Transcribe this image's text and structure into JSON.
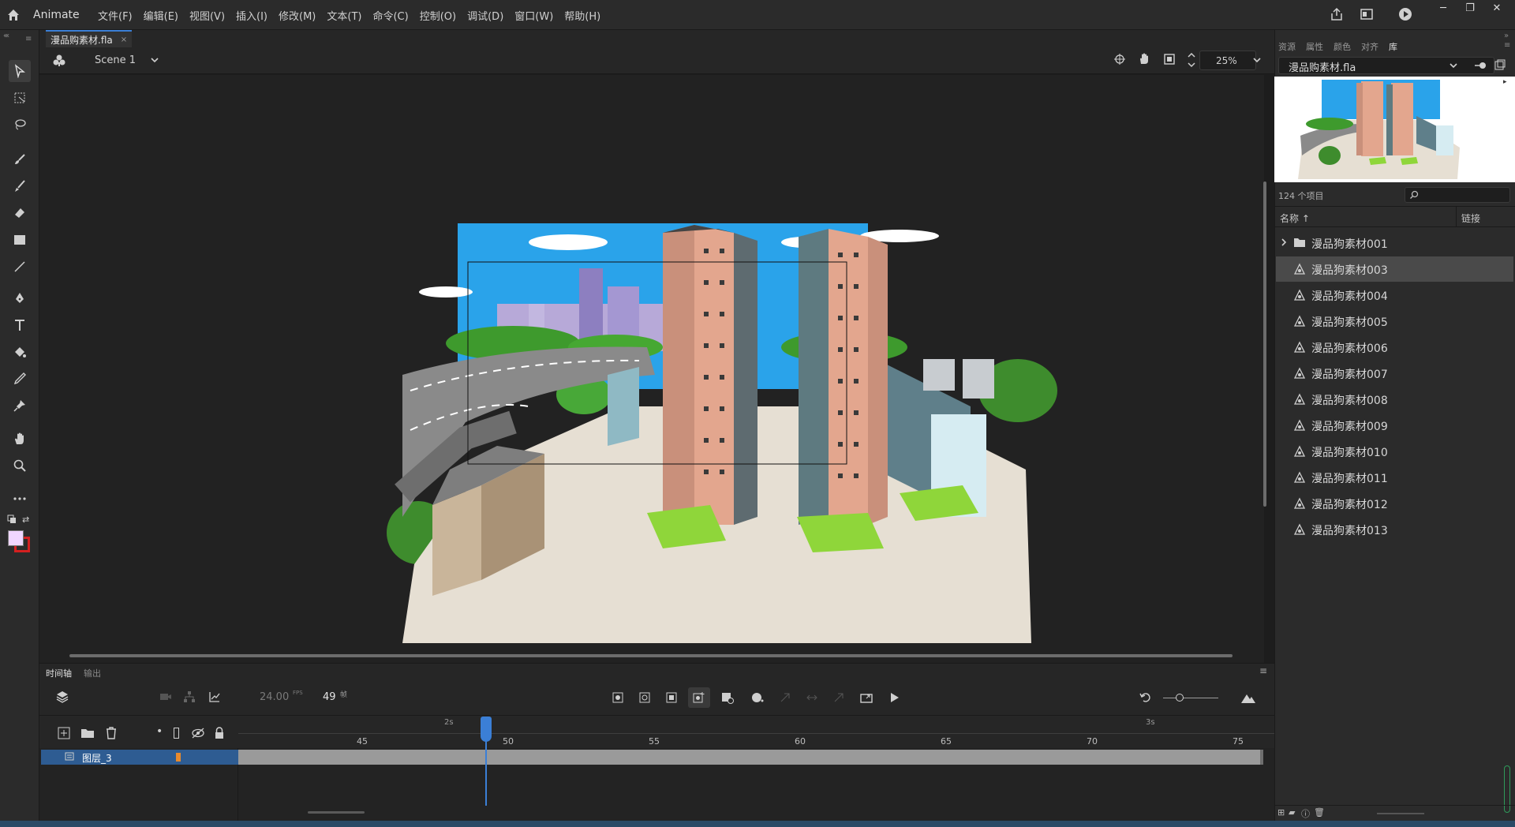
{
  "app": {
    "name": "Animate"
  },
  "menu": [
    "文件(F)",
    "编辑(E)",
    "视图(V)",
    "插入(I)",
    "修改(M)",
    "文本(T)",
    "命令(C)",
    "控制(O)",
    "调试(D)",
    "窗口(W)",
    "帮助(H)"
  ],
  "document": {
    "tab_label": "漫品购素材.fla",
    "tab_close": "×"
  },
  "editbar": {
    "scene": "Scene 1",
    "zoom": "25%"
  },
  "timeline": {
    "tabs": [
      "时间轴",
      "输出"
    ],
    "fps": "24.00",
    "fps_unit": "FPS",
    "current_frame": "49",
    "frame_unit": "帧",
    "ruler_frames": [
      "45",
      "50",
      "55",
      "60",
      "65",
      "70",
      "75"
    ],
    "ruler_seconds": [
      "2s",
      "3s"
    ],
    "playhead_frame": 49,
    "layers": [
      {
        "name": "图层_3"
      }
    ]
  },
  "right_panel": {
    "tabs": [
      "资源",
      "属性",
      "颜色",
      "对齐",
      "库"
    ],
    "active_tab": "库",
    "document_select": "漫品购素材.fla",
    "item_count": "124 个项目",
    "columns": {
      "name": "名称 ↑",
      "linkage": "链接"
    },
    "items": [
      {
        "label": "漫品狗素材001",
        "type": "folder",
        "selected": false
      },
      {
        "label": "漫品狗素材003",
        "type": "graphic",
        "selected": true
      },
      {
        "label": "漫品狗素材004",
        "type": "graphic",
        "selected": false
      },
      {
        "label": "漫品狗素材005",
        "type": "graphic",
        "selected": false
      },
      {
        "label": "漫品狗素材006",
        "type": "graphic",
        "selected": false
      },
      {
        "label": "漫品狗素材007",
        "type": "graphic",
        "selected": false
      },
      {
        "label": "漫品狗素材008",
        "type": "graphic",
        "selected": false
      },
      {
        "label": "漫品狗素材009",
        "type": "graphic",
        "selected": false
      },
      {
        "label": "漫品狗素材010",
        "type": "graphic",
        "selected": false
      },
      {
        "label": "漫品狗素材011",
        "type": "graphic",
        "selected": false
      },
      {
        "label": "漫品狗素材012",
        "type": "graphic",
        "selected": false
      },
      {
        "label": "漫品狗素材013",
        "type": "graphic",
        "selected": false
      }
    ]
  },
  "colors": {
    "accent": "#3b7fd6",
    "fill_swatch": "#f0d6ff",
    "stroke_swatch": "#d42020",
    "layer_highlight": "#2e5c92"
  }
}
